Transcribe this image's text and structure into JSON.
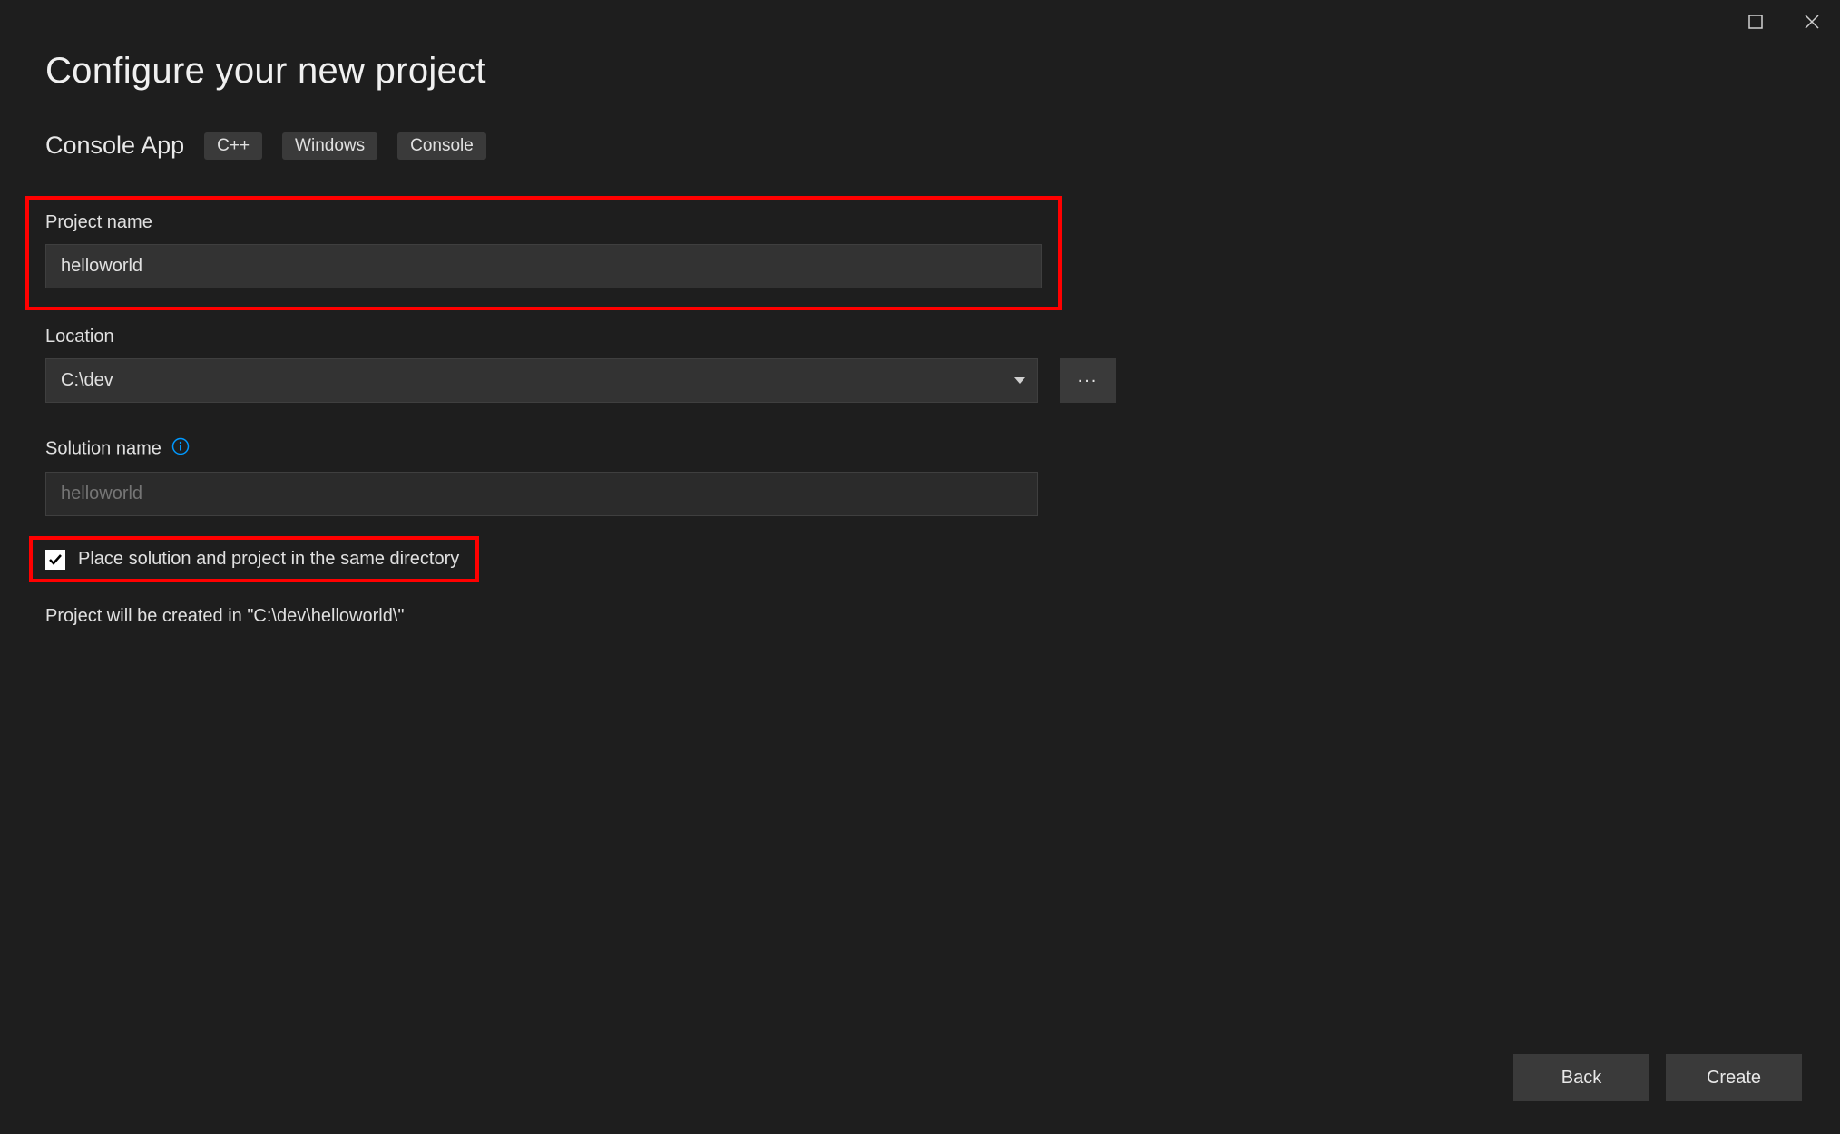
{
  "title": "Configure your new project",
  "template": {
    "name": "Console App",
    "tags": [
      "C++",
      "Windows",
      "Console"
    ]
  },
  "fields": {
    "projectName": {
      "label": "Project name",
      "value": "helloworld"
    },
    "location": {
      "label": "Location",
      "value": "C:\\dev",
      "browse": "..."
    },
    "solutionName": {
      "label": "Solution name",
      "placeholder": "helloworld"
    },
    "sameDirectory": {
      "label": "Place solution and project in the same directory",
      "checked": true
    }
  },
  "creationPath": "Project will be created in \"C:\\dev\\helloworld\\\"",
  "footer": {
    "back": "Back",
    "create": "Create"
  }
}
